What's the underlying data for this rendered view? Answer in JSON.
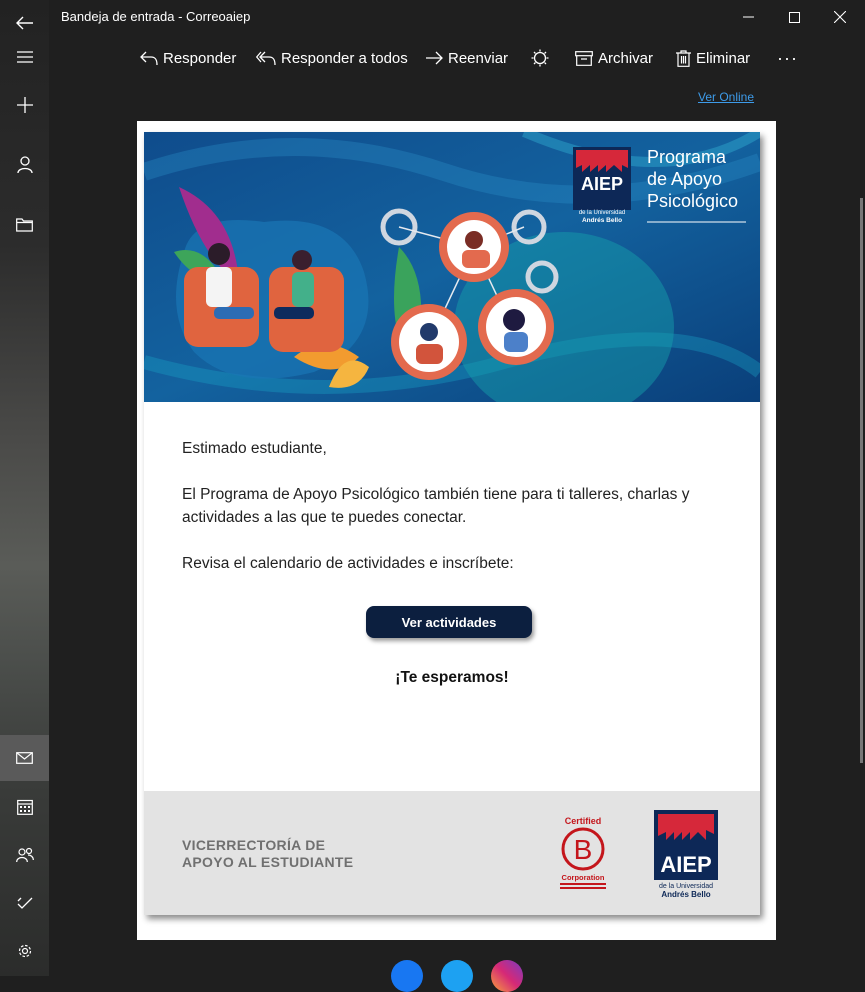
{
  "window": {
    "title": "Bandeja de entrada - Correoaiep"
  },
  "toolbar": {
    "reply": "Responder",
    "reply_all": "Responder a todos",
    "forward": "Reenviar",
    "archive": "Archivar",
    "delete": "Eliminar",
    "more": "···"
  },
  "email": {
    "view_online": "Ver Online",
    "banner": {
      "logo_text": "AIEP",
      "logo_sub1": "de la Universidad",
      "logo_sub2": "Andrés Bello",
      "program_line1": "Programa",
      "program_line2": "de Apoyo",
      "program_line3": "Psicológico"
    },
    "greeting": "Estimado estudiante,",
    "paragraph1": "El Programa de Apoyo Psicológico también tiene para ti talleres, charlas y actividades a las que te puedes conectar.",
    "paragraph2": "Revisa el calendario de actividades e inscríbete:",
    "cta_label": "Ver actividades",
    "tagline": "¡Te esperamos!",
    "footer": {
      "vice_line1": "VICERRECTORÍA DE",
      "vice_line2": "APOYO AL ESTUDIANTE",
      "bcorp_top": "Certified",
      "bcorp_letter": "B",
      "bcorp_bottom": "Corporation",
      "logo_text": "AIEP",
      "logo_sub1": "de la Universidad",
      "logo_sub2": "Andrés Bello"
    }
  },
  "colors": {
    "accent_link": "#3d9be9",
    "cta_bg": "#0c1f3f",
    "aiep_navy": "#0d2857",
    "aiep_red": "#d6283a",
    "bcorp_red": "#c4161c"
  }
}
